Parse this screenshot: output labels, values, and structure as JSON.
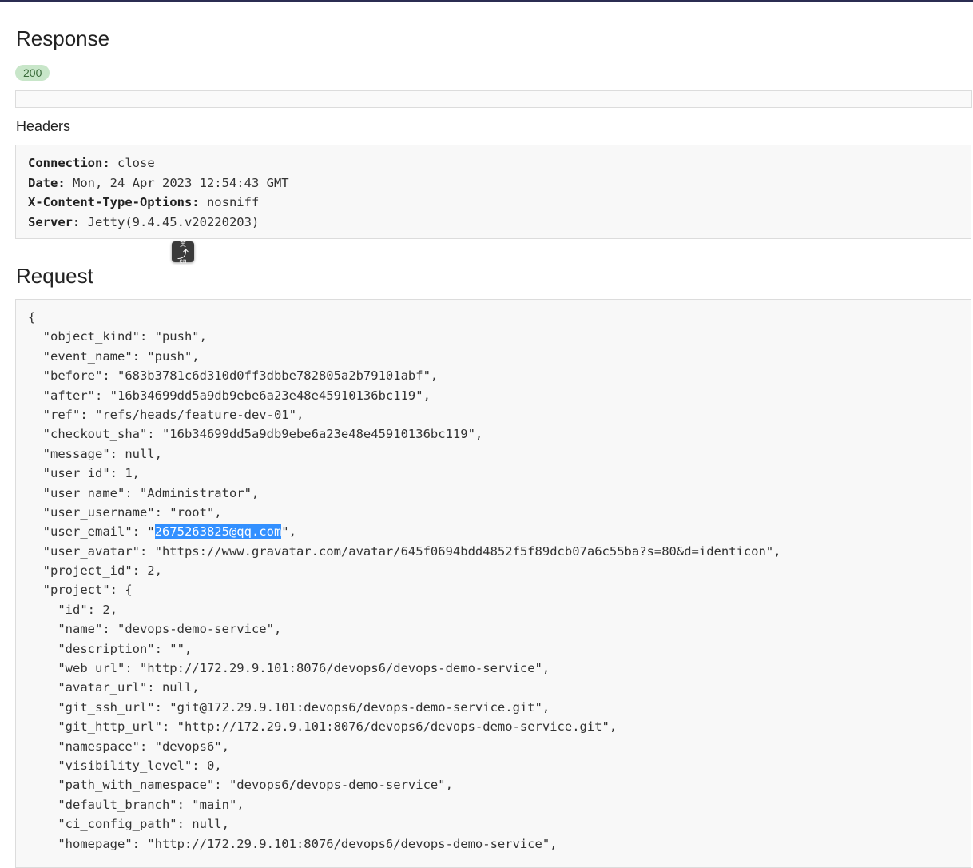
{
  "response": {
    "title": "Response",
    "status_code": "200",
    "headers_title": "Headers",
    "headers": [
      {
        "key": "Connection:",
        "value": " close"
      },
      {
        "key": "Date:",
        "value": " Mon, 24 Apr 2023 12:54:43 GMT"
      },
      {
        "key": "X-Content-Type-Options:",
        "value": " nosniff"
      },
      {
        "key": "Server:",
        "value": " Jetty(9.4.45.v20220203)"
      }
    ]
  },
  "request": {
    "title": "Request",
    "lines": [
      "{",
      "  \"object_kind\": \"push\",",
      "  \"event_name\": \"push\",",
      "  \"before\": \"683b3781c6d310d0ff3dbbe782805a2b79101abf\",",
      "  \"after\": \"16b34699dd5a9db9ebe6a23e48e45910136bc119\",",
      "  \"ref\": \"refs/heads/feature-dev-01\",",
      "  \"checkout_sha\": \"16b34699dd5a9db9ebe6a23e48e45910136bc119\",",
      "  \"message\": null,",
      "  \"user_id\": 1,",
      "  \"user_name\": \"Administrator\",",
      "  \"user_username\": \"root\","
    ],
    "email_line": {
      "prefix": "  \"user_email\": \"",
      "selected": "2675263825@qq.com",
      "suffix": "\","
    },
    "lines_after": [
      "  \"user_avatar\": \"https://www.gravatar.com/avatar/645f0694bdd4852f5f89dcb07a6c55ba?s=80&d=identicon\",",
      "  \"project_id\": 2,",
      "  \"project\": {",
      "    \"id\": 2,",
      "    \"name\": \"devops-demo-service\",",
      "    \"description\": \"\",",
      "    \"web_url\": \"http://172.29.9.101:8076/devops6/devops-demo-service\",",
      "    \"avatar_url\": null,",
      "    \"git_ssh_url\": \"git@172.29.9.101:devops6/devops-demo-service.git\",",
      "    \"git_http_url\": \"http://172.29.9.101:8076/devops6/devops-demo-service.git\",",
      "    \"namespace\": \"devops6\",",
      "    \"visibility_level\": 0,",
      "    \"path_with_namespace\": \"devops6/devops-demo-service\",",
      "    \"default_branch\": \"main\",",
      "    \"ci_config_path\": null,",
      "    \"homepage\": \"http://172.29.9.101:8076/devops6/devops-demo-service\","
    ]
  },
  "ime_popup": {
    "top_glyph": "英",
    "main_glyph": "⤴",
    "bottom_text": "en"
  },
  "colors": {
    "topbar": "#2b2d52",
    "badge_bg": "#c8e6c9",
    "selection": "#3390ff"
  }
}
